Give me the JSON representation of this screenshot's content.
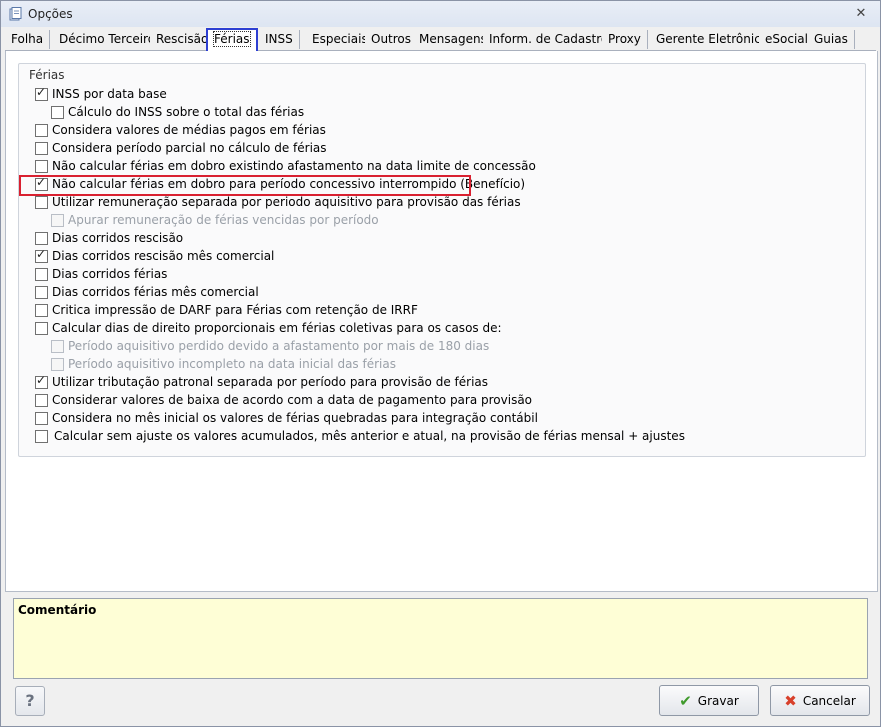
{
  "window": {
    "title": "Opções"
  },
  "tabs": [
    "Folha",
    "Décimo Terceiro",
    "Rescisão",
    "Férias",
    "INSS",
    "Especiais",
    "Outros",
    "Mensagens",
    "Inform. de Cadastro",
    "Proxy",
    "Gerente Eletrônico",
    "eSocial",
    "Guias"
  ],
  "active_tab": "Férias",
  "group": {
    "title": "Férias",
    "options": [
      {
        "label": "INSS por data base",
        "checked": true,
        "enabled": true
      },
      {
        "label": "Cálculo do INSS sobre o  total das férias",
        "checked": false,
        "enabled": true
      },
      {
        "label": "Considera valores de médias pagos em férias",
        "checked": false,
        "enabled": true
      },
      {
        "label": "Considera período parcial no cálculo de férias",
        "checked": false,
        "enabled": true
      },
      {
        "label": "Não calcular férias em dobro existindo afastamento na data limite de concessão",
        "checked": false,
        "enabled": true
      },
      {
        "label": "Não calcular férias em dobro para período concessivo interrompido (Benefício)",
        "checked": true,
        "enabled": true
      },
      {
        "label": "Utilizar remuneração separada por periodo aquisitivo para provisão das férias",
        "checked": false,
        "enabled": true
      },
      {
        "label": "Apurar remuneração de férias vencidas por período",
        "checked": false,
        "enabled": false
      },
      {
        "label": "Dias corridos rescisão",
        "checked": false,
        "enabled": true
      },
      {
        "label": "Dias corridos rescisão mês comercial",
        "checked": true,
        "enabled": true
      },
      {
        "label": "Dias corridos férias",
        "checked": false,
        "enabled": true
      },
      {
        "label": "Dias corridos férias mês comercial",
        "checked": false,
        "enabled": true
      },
      {
        "label": "Critica impressão de DARF para Férias com retenção de IRRF",
        "checked": false,
        "enabled": true
      },
      {
        "label": "Calcular dias de direito proporcionais em férias coletivas para os casos de:",
        "checked": false,
        "enabled": true
      },
      {
        "label": "Período aquisitivo perdido devido a afastamento por mais de 180 dias",
        "checked": false,
        "enabled": false
      },
      {
        "label": "Período aquisitivo incompleto na data inicial das férias",
        "checked": false,
        "enabled": false
      },
      {
        "label": "Utilizar tributação patronal separada por período para provisão de férias",
        "checked": true,
        "enabled": true
      },
      {
        "label": "Considerar valores de baixa de acordo com a data de pagamento para provisão",
        "checked": false,
        "enabled": true
      },
      {
        "label": "Considera no mês inicial os valores de férias quebradas para integração contábil",
        "checked": false,
        "enabled": true
      },
      {
        "label": "Calcular sem ajuste os valores acumulados, mês anterior e atual, na provisão de férias mensal + ajustes",
        "checked": false,
        "enabled": true
      }
    ]
  },
  "comment": {
    "label": "Comentário",
    "value": ""
  },
  "buttons": {
    "help": "?",
    "save": "Gravar",
    "cancel": "Cancelar"
  },
  "colors": {
    "highlight": "#d92030",
    "active_tab_border": "#2d3fd2",
    "comment_bg": "#fefed6"
  }
}
